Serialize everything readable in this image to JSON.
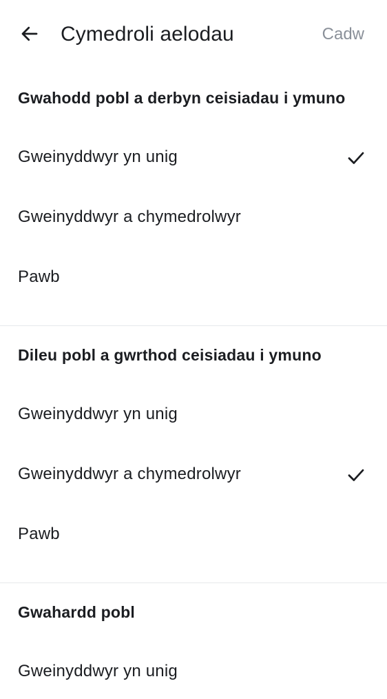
{
  "header": {
    "title": "Cymedroli aelodau",
    "save_label": "Cadw",
    "back_icon": "arrow-left-icon"
  },
  "sections": [
    {
      "title": "Gwahodd pobl a derbyn ceisiadau i ymuno",
      "options": [
        {
          "label": "Gweinyddwyr yn unig",
          "selected": true
        },
        {
          "label": "Gweinyddwyr a chymedrolwyr",
          "selected": false
        },
        {
          "label": "Pawb",
          "selected": false
        }
      ]
    },
    {
      "title": "Dileu pobl a gwrthod ceisiadau i ymuno",
      "options": [
        {
          "label": "Gweinyddwyr yn unig",
          "selected": false
        },
        {
          "label": "Gweinyddwyr a chymedrolwyr",
          "selected": true
        },
        {
          "label": "Pawb",
          "selected": false
        }
      ]
    },
    {
      "title": "Gwahardd pobl",
      "options": [
        {
          "label": "Gweinyddwyr yn unig",
          "selected": false
        }
      ]
    }
  ],
  "colors": {
    "text": "#1b1d21",
    "muted": "#8a9099",
    "divider": "#e6e8eb"
  }
}
